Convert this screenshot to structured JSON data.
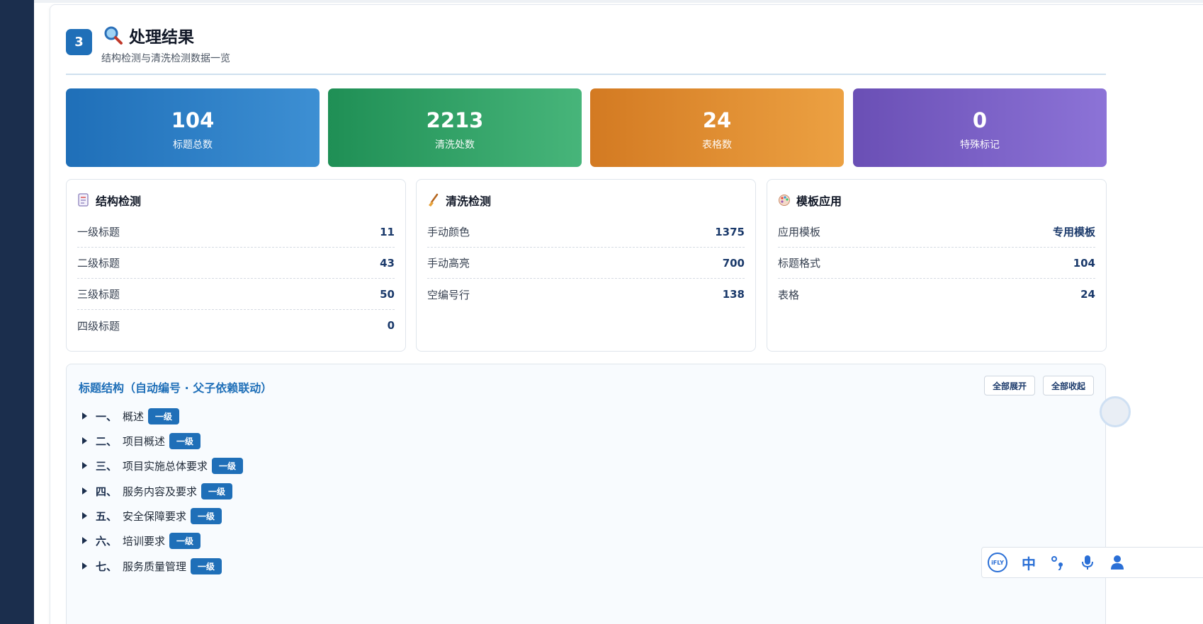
{
  "header": {
    "step": "3",
    "title": "处理结果",
    "subtitle": "结构检测与清洗检测数据一览"
  },
  "stats": [
    {
      "value": "104",
      "label": "标题总数"
    },
    {
      "value": "2213",
      "label": "清洗处数"
    },
    {
      "value": "24",
      "label": "表格数"
    },
    {
      "value": "0",
      "label": "特殊标记"
    }
  ],
  "structure": {
    "title": "结构检测",
    "icon": "document-icon",
    "rows": [
      {
        "label": "一级标题",
        "value": "11"
      },
      {
        "label": "二级标题",
        "value": "43"
      },
      {
        "label": "三级标题",
        "value": "50"
      },
      {
        "label": "四级标题",
        "value": "0"
      }
    ]
  },
  "cleaning": {
    "title": "清洗检测",
    "icon": "broom-icon",
    "rows": [
      {
        "label": "手动颜色",
        "value": "1375"
      },
      {
        "label": "手动高亮",
        "value": "700"
      },
      {
        "label": "空编号行",
        "value": "138"
      }
    ]
  },
  "template": {
    "title": "模板应用",
    "icon": "palette-icon",
    "rows": [
      {
        "label": "应用模板",
        "value": "专用模板"
      },
      {
        "label": "标题格式",
        "value": "104"
      },
      {
        "label": "表格",
        "value": "24"
      }
    ]
  },
  "tree": {
    "title": "标题结构（自动编号 · 父子依赖联动）",
    "expand_all": "全部展开",
    "collapse_all": "全部收起",
    "items": [
      {
        "num": "一、",
        "text": "概述",
        "level": "一级"
      },
      {
        "num": "二、",
        "text": "项目概述",
        "level": "一级"
      },
      {
        "num": "三、",
        "text": "项目实施总体要求",
        "level": "一级"
      },
      {
        "num": "四、",
        "text": "服务内容及要求",
        "level": "一级"
      },
      {
        "num": "五、",
        "text": "安全保障要求",
        "level": "一级"
      },
      {
        "num": "六、",
        "text": "培训要求",
        "level": "一级"
      },
      {
        "num": "七、",
        "text": "服务质量管理",
        "level": "一级"
      }
    ]
  },
  "ime": {
    "logo": "iFLY",
    "mode": "中"
  },
  "colors": {
    "primary": "#1f6fb8",
    "green": "#1f8f55",
    "orange": "#d37a22",
    "purple": "#6a4fb5",
    "sidebar": "#1b2e4d"
  }
}
